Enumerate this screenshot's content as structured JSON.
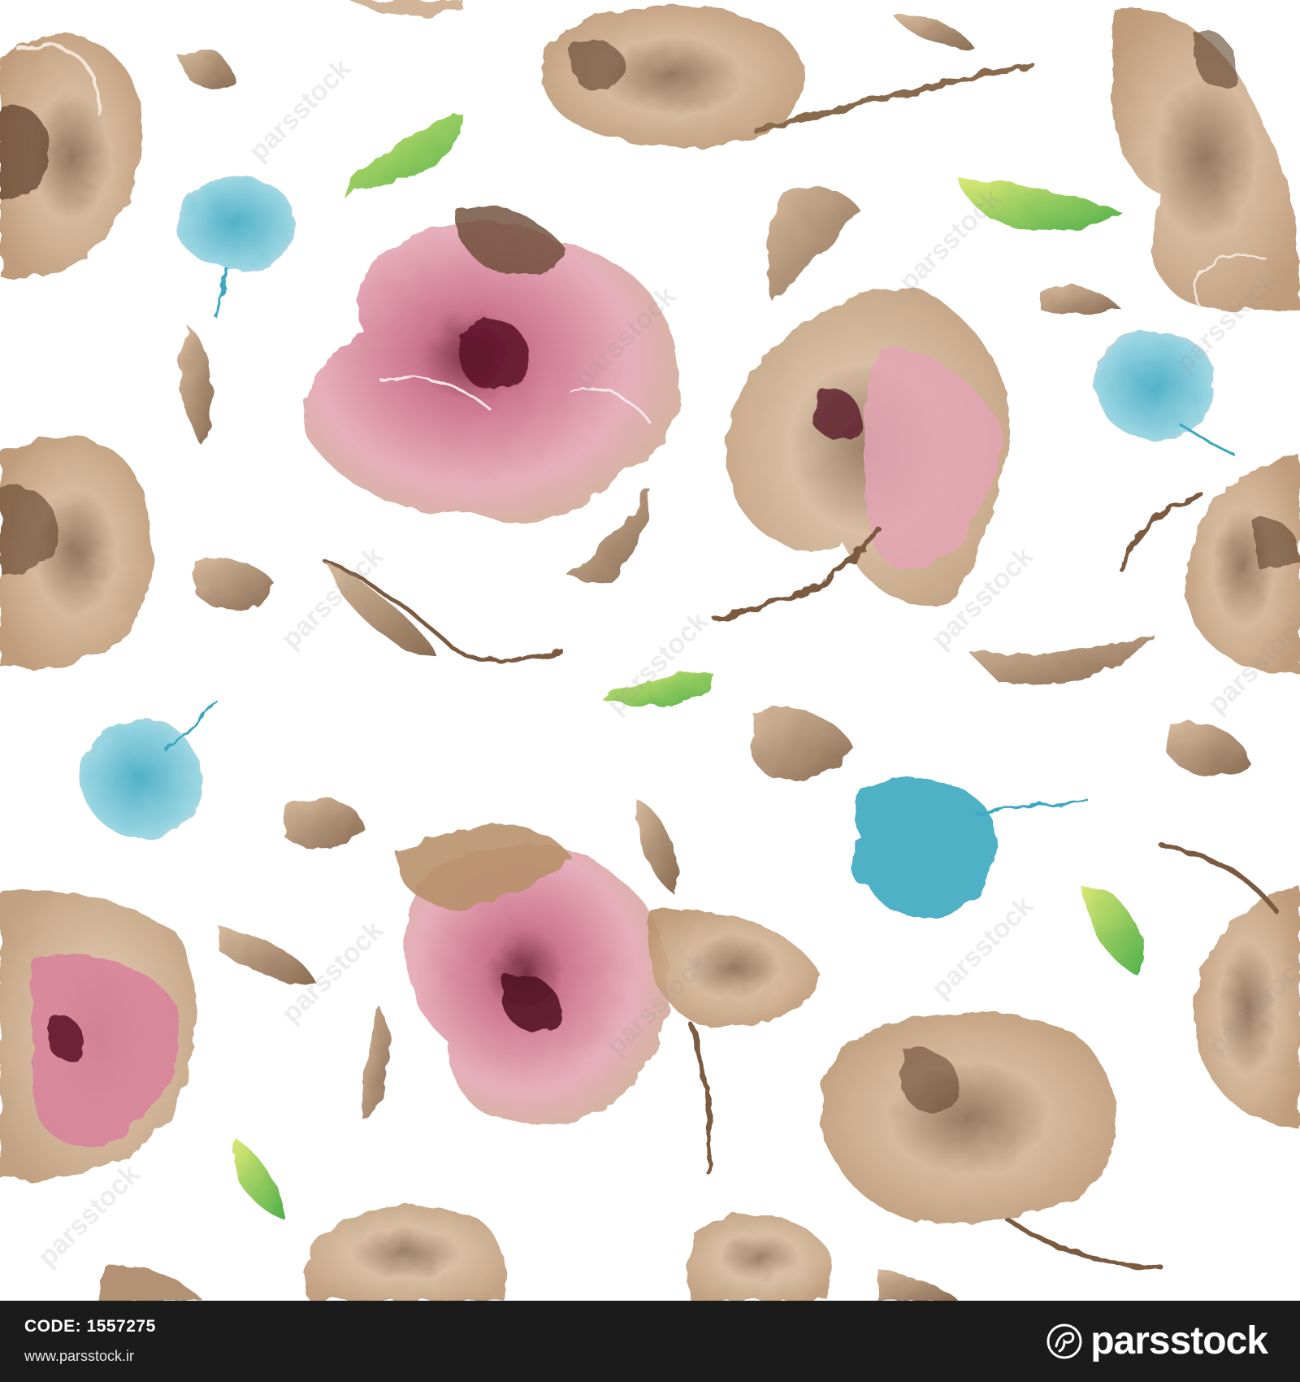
{
  "footer": {
    "code_label": "CODE:",
    "code_value": "1557275",
    "url": "www.parsstock.ir",
    "brand": "parsstock"
  },
  "watermark": {
    "text": "parsstock",
    "color": "#9a9a9a"
  },
  "colors": {
    "background": "#ffffff",
    "sepia_light": "#d9b99a",
    "sepia_mid": "#b08a68",
    "sepia_dark": "#6e5038",
    "rose": "#d98a9e",
    "rose_dark": "#9c3350",
    "sky_blue": "#6ec3d6",
    "teal_blue": "#3aa8c0",
    "leaf_green": "#7cc43a",
    "footer_bg": "#1b1b1b"
  }
}
